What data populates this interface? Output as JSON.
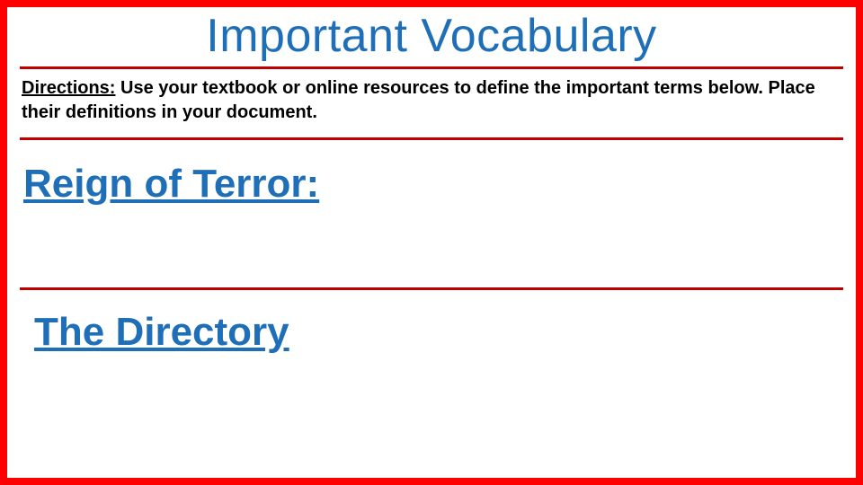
{
  "colors": {
    "border": "#ff0000",
    "heading": "#1f6fb8",
    "rule": "#c00000",
    "text": "#000000"
  },
  "title": "Important Vocabulary",
  "directions": {
    "label": "Directions:",
    "body": " Use your textbook or online resources to define the important terms below. Place their definitions in your document."
  },
  "terms": [
    {
      "label": "Reign of Terror:"
    },
    {
      "label": "The Directory"
    }
  ]
}
